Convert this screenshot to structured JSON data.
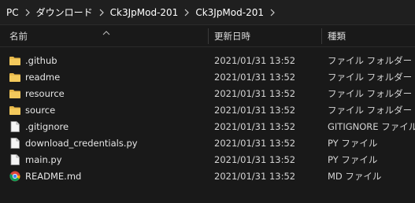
{
  "breadcrumb": {
    "items": [
      "PC",
      "ダウンロード",
      "Ck3JpMod-201",
      "Ck3JpMod-201"
    ]
  },
  "columns": {
    "name": "名前",
    "date": "更新日時",
    "type": "種類"
  },
  "sort": {
    "column": "name",
    "direction": "ascending"
  },
  "rows": [
    {
      "name": ".github",
      "date": "2021/01/31 13:52",
      "type": "ファイル フォルダー",
      "icon": "folder-icon"
    },
    {
      "name": "readme",
      "date": "2021/01/31 13:52",
      "type": "ファイル フォルダー",
      "icon": "folder-icon"
    },
    {
      "name": "resource",
      "date": "2021/01/31 13:52",
      "type": "ファイル フォルダー",
      "icon": "folder-icon"
    },
    {
      "name": "source",
      "date": "2021/01/31 13:52",
      "type": "ファイル フォルダー",
      "icon": "folder-icon"
    },
    {
      "name": ".gitignore",
      "date": "2021/01/31 13:52",
      "type": "GITIGNORE ファイル",
      "icon": "file-icon"
    },
    {
      "name": "download_credentials.py",
      "date": "2021/01/31 13:52",
      "type": "PY ファイル",
      "icon": "file-icon"
    },
    {
      "name": "main.py",
      "date": "2021/01/31 13:52",
      "type": "PY ファイル",
      "icon": "file-icon"
    },
    {
      "name": "README.md",
      "date": "2021/01/31 13:52",
      "type": "MD ファイル",
      "icon": "chrome-icon"
    }
  ],
  "colors": {
    "background": "#191919",
    "folder": "#e8b84a",
    "text": "#ffffff"
  }
}
